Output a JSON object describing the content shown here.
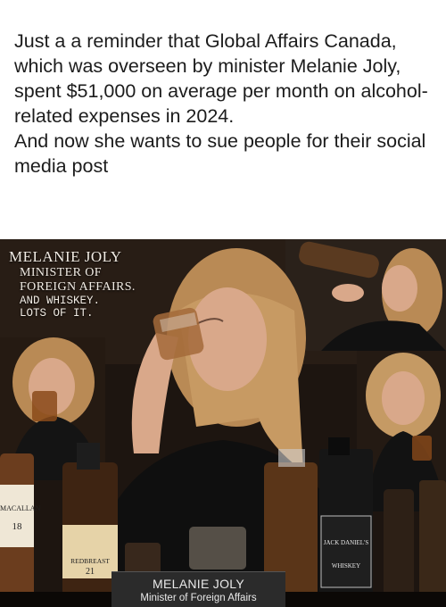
{
  "post": {
    "paragraph1": "Just a a reminder that Global Affairs Canada, which was overseen by minister Melanie Joly, spent $51,000 on average per month on alcohol-related expenses in 2024.",
    "paragraph2": "And now she wants to sue people for their social media post"
  },
  "meme_caption": {
    "name": "MELANIE JOLY",
    "title_line1": "MINISTER OF",
    "title_line2": "FOREIGN AFFAIRS.",
    "line3": "AND WHISKEY.",
    "line4": "LOTS OF IT."
  },
  "nameplate": {
    "name": "MELANIE JOLY",
    "role": "Minister of Foreign Affairs"
  },
  "bottle_labels": {
    "macallan": "MACALLAN",
    "macallan_age": "18",
    "redbreast": "REDBREAST",
    "redbreast_age": "21",
    "jack": "JACK DANIEL'S",
    "jack_sub": "WHISKEY"
  },
  "colors": {
    "photo_bg": "#1f1712",
    "hair": "#b98a55",
    "skin": "#d9a88a",
    "whiskey": "#8a4a1a"
  }
}
